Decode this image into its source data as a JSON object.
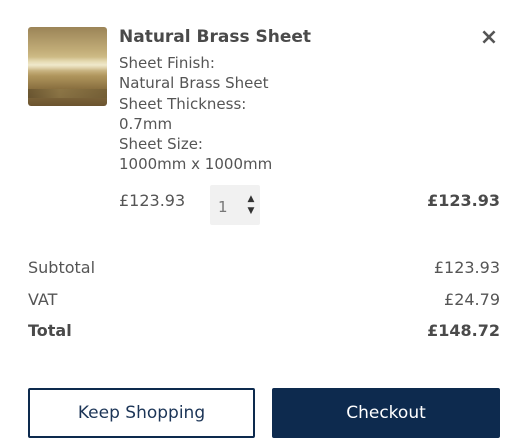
{
  "item": {
    "title": "Natural Brass Sheet",
    "close_glyph": "×",
    "image_icon": "brass-sheet-thumbnail",
    "options": [
      {
        "label": "Sheet Finish:",
        "value": "Natural Brass Sheet"
      },
      {
        "label": "Sheet Thickness:",
        "value": "0.7mm"
      },
      {
        "label": "Sheet Size:",
        "value": "1000mm x 1000mm"
      }
    ],
    "unit_price": "£123.93",
    "quantity": "1",
    "line_total": "£123.93"
  },
  "summary": {
    "subtotal_label": "Subtotal",
    "subtotal_value": "£123.93",
    "vat_label": "VAT",
    "vat_value": "£24.79",
    "total_label": "Total",
    "total_value": "£148.72"
  },
  "buttons": {
    "keep_shopping": "Keep Shopping",
    "checkout": "Checkout"
  },
  "colors": {
    "brand_navy": "#0d2a4e",
    "text": "#4a4a4a",
    "qty_bg": "#f1f1f1"
  }
}
